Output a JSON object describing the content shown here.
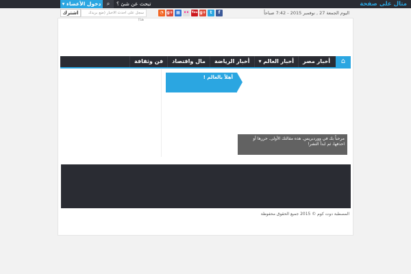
{
  "topbar": {
    "site_title": "مثال على صفحة",
    "login_label": "دخول الأعضاء ▾",
    "search_icon": "⌕",
    "search_label": "تبحث عن شئ ؟"
  },
  "infobar": {
    "date_text": "اليوم الجمعة 27 , نوفمبر 2015 - 7:42 صباحاً",
    "social": [
      {
        "icon": "facebook-icon",
        "glyph": "f",
        "color": "#3b5998"
      },
      {
        "icon": "google-plus-icon",
        "glyph": "g+",
        "color": "#dd4b39"
      },
      {
        "icon": "youtube-icon",
        "glyph": "You",
        "color": "#cc181e"
      },
      {
        "icon": "flickr-icon",
        "glyph": "••",
        "color": "#e0e0e0"
      },
      {
        "icon": "delicious-icon",
        "glyph": "▦",
        "color": "#3274d1"
      },
      {
        "icon": "google-plus-alt-icon",
        "glyph": "g+",
        "color": "#dd4b39"
      },
      {
        "icon": "rss-icon",
        "glyph": "◔",
        "color": "#f26522"
      }
    ],
    "subscribe_label": "اشترك",
    "subscribe_placeholder": "سجل على احدث الاخبار (ضع بريدك هنا)"
  },
  "nav": {
    "home_icon": "⌂",
    "items": [
      "أخبار مصر",
      "أخبار العالم ▾",
      "أخبار الرياضة",
      "مال واقتصاد",
      "فن وثقافة"
    ]
  },
  "welcome_title": "أهلاً بالعالم !",
  "caption_text": "مرحباً بك في ووردبريس. هذه مقالتك الأولى. حررها أو احذفها، ثم ابدأ النشر!",
  "copyright": "المصطبة دوت كوم © 2015 جميع الحقوق محفوظة",
  "colors": {
    "accent": "#2ba6e1",
    "dark": "#2a2c33"
  }
}
